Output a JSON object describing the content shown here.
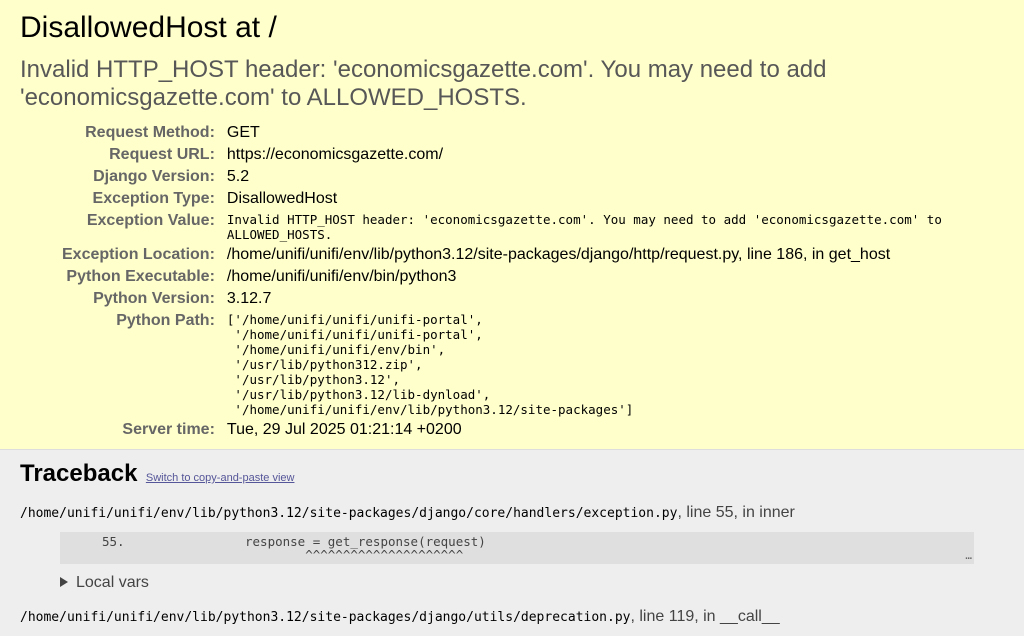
{
  "title": "DisallowedHost at /",
  "exception_value_heading": "Invalid HTTP_HOST header: 'economicsgazette.com'. You may need to add 'economicsgazette.com' to ALLOWED_HOSTS.",
  "meta": {
    "request_method": {
      "label": "Request Method:",
      "value": "GET"
    },
    "request_url": {
      "label": "Request URL:",
      "value": "https://economicsgazette.com/"
    },
    "django_version": {
      "label": "Django Version:",
      "value": "5.2"
    },
    "exception_type": {
      "label": "Exception Type:",
      "value": "DisallowedHost"
    },
    "exception_value": {
      "label": "Exception Value:",
      "value": "Invalid HTTP_HOST header: 'economicsgazette.com'. You may need to add 'economicsgazette.com' to ALLOWED_HOSTS."
    },
    "exception_location": {
      "label": "Exception Location:",
      "value": "/home/unifi/unifi/env/lib/python3.12/site-packages/django/http/request.py, line 186, in get_host"
    },
    "python_executable": {
      "label": "Python Executable:",
      "value": "/home/unifi/unifi/env/bin/python3"
    },
    "python_version": {
      "label": "Python Version:",
      "value": "3.12.7"
    },
    "python_path": {
      "label": "Python Path:",
      "value": "['/home/unifi/unifi/unifi-portal',\n '/home/unifi/unifi/unifi-portal',\n '/home/unifi/unifi/env/bin',\n '/usr/lib/python312.zip',\n '/usr/lib/python3.12',\n '/usr/lib/python3.12/lib-dynload',\n '/home/unifi/unifi/env/lib/python3.12/site-packages']"
    },
    "server_time": {
      "label": "Server time:",
      "value": "Tue, 29 Jul 2025 01:21:14 +0200"
    }
  },
  "traceback": {
    "heading": "Traceback",
    "switch_link": "Switch to copy-and-paste view",
    "frames": [
      {
        "file": "/home/unifi/unifi/env/lib/python3.12/site-packages/django/core/handlers/exception.py",
        "suffix": ", line 55, in inner",
        "line_no": "55.",
        "code": "                response = get_response(request)",
        "carets": "                           ^^^^^^^^^^^^^^^^^^^^^",
        "ellipsis": "…",
        "local_vars": "Local vars"
      },
      {
        "file": "/home/unifi/unifi/env/lib/python3.12/site-packages/django/utils/deprecation.py",
        "suffix": ", line 119, in __call__"
      }
    ]
  }
}
